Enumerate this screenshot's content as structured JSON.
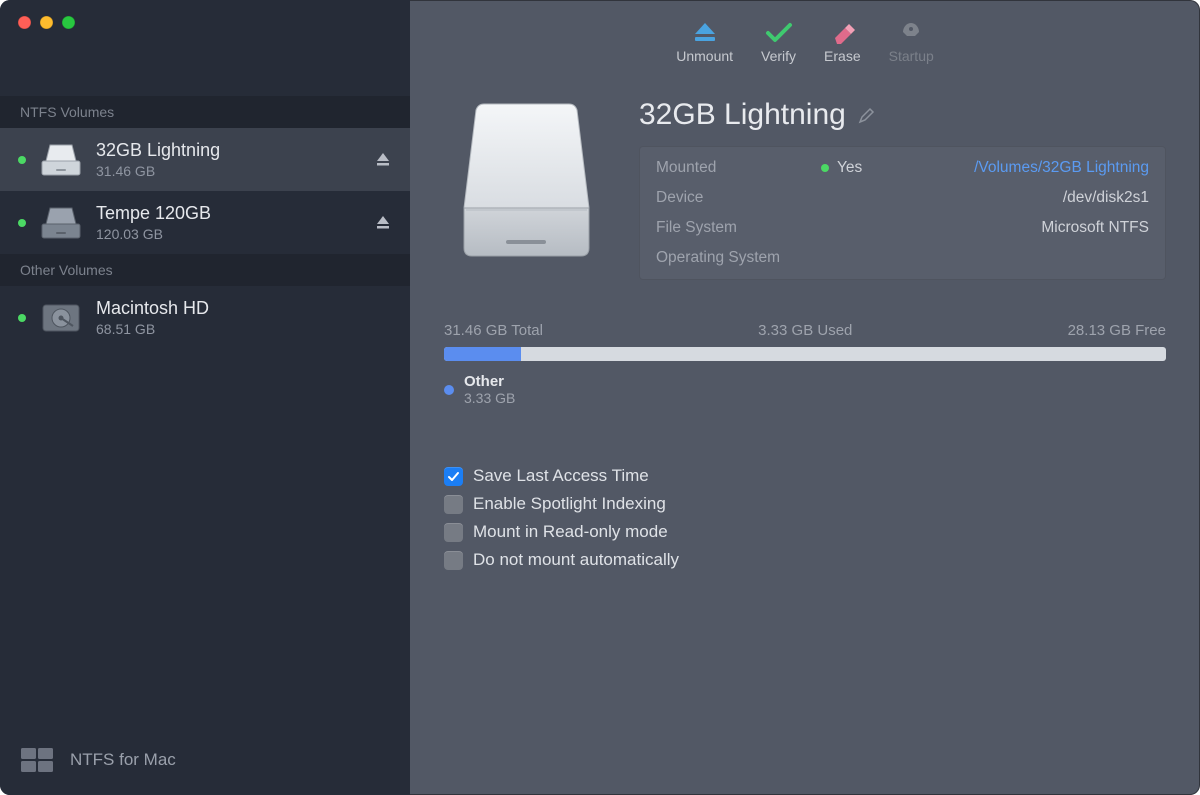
{
  "sidebar": {
    "section1": "NTFS Volumes",
    "section2": "Other Volumes",
    "volumes": [
      {
        "name": "32GB Lightning",
        "size": "31.46 GB"
      },
      {
        "name": "Tempe 120GB",
        "size": "120.03 GB"
      },
      {
        "name": "Macintosh HD",
        "size": "68.51 GB"
      }
    ],
    "footer": "NTFS for Mac"
  },
  "toolbar": {
    "unmount": "Unmount",
    "verify": "Verify",
    "erase": "Erase",
    "startup": "Startup"
  },
  "volume": {
    "title": "32GB Lightning",
    "info": {
      "mounted_label": "Mounted",
      "mounted_value": "Yes",
      "mounted_path": "/Volumes/32GB Lightning",
      "device_label": "Device",
      "device_value": "/dev/disk2s1",
      "fs_label": "File System",
      "fs_value": "Microsoft NTFS",
      "os_label": "Operating System",
      "os_value": ""
    }
  },
  "usage": {
    "total": "31.46 GB Total",
    "used": "3.33 GB Used",
    "free": "28.13 GB Free",
    "fill_percent": 10.6,
    "legend_label": "Other",
    "legend_value": "3.33 GB"
  },
  "options": {
    "o1": "Save Last Access Time",
    "o2": "Enable Spotlight Indexing",
    "o3": "Mount in Read-only mode",
    "o4": "Do not mount automatically"
  }
}
